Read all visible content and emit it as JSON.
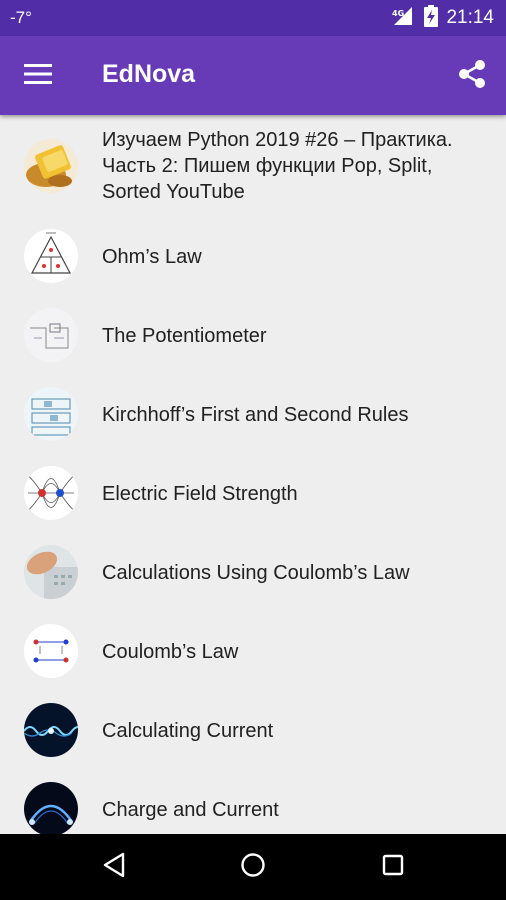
{
  "status_bar": {
    "temperature": "-7°",
    "network": "4G",
    "time": "21:14"
  },
  "app_bar": {
    "title": "EdNova",
    "menu_icon": "hamburger-menu-icon",
    "share_icon": "share-icon"
  },
  "list": {
    "items": [
      {
        "title": "Изучаем Python 2019 #26 – Практика. Часть 2: Пишем функции Pop, Split, Sorted YouTube",
        "thumb": "python-tutorial-thumbnail"
      },
      {
        "title": "Ohm’s Law",
        "thumb": "ohms-law-triangle-thumbnail"
      },
      {
        "title": "The Potentiometer",
        "thumb": "potentiometer-circuit-thumbnail"
      },
      {
        "title": "Kirchhoff’s First and Second Rules",
        "thumb": "kirchhoff-circuit-thumbnail"
      },
      {
        "title": "Electric Field Strength",
        "thumb": "electric-field-lines-thumbnail"
      },
      {
        "title": "Calculations Using Coulomb’s Law",
        "thumb": "calculator-hand-thumbnail"
      },
      {
        "title": "Coulomb’s Law",
        "thumb": "coulomb-charges-thumbnail"
      },
      {
        "title": "Calculating Current",
        "thumb": "current-wave-thumbnail"
      },
      {
        "title": "Charge and Current",
        "thumb": "charge-arc-thumbnail"
      }
    ]
  },
  "nav_bar": {
    "back_icon": "back-triangle-icon",
    "home_icon": "home-circle-icon",
    "recents_icon": "recents-square-icon"
  },
  "colors": {
    "status_bar": "#512da8",
    "app_bar": "#673ab7",
    "list_background": "#eeeeee",
    "nav_bar": "#000000"
  }
}
